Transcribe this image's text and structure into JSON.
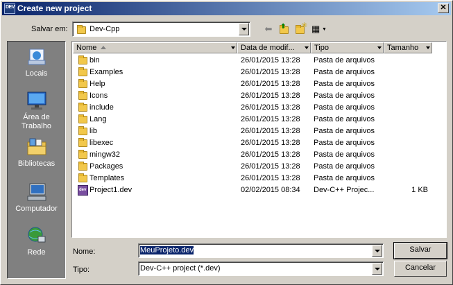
{
  "window": {
    "title": "Create new project",
    "app_icon_text": "DEV"
  },
  "toolbar": {
    "lookin_label": "Salvar em:",
    "lookin_value": "Dev-Cpp",
    "back_icon": "back-arrow-icon",
    "up_icon": "up-folder-icon",
    "new_folder_icon": "new-folder-icon",
    "views_icon": "views-menu-icon"
  },
  "places": [
    {
      "label": "Locais",
      "icon": "recent-places-icon"
    },
    {
      "label": "Área de Trabalho",
      "icon": "desktop-icon"
    },
    {
      "label": "Bibliotecas",
      "icon": "libraries-icon"
    },
    {
      "label": "Computador",
      "icon": "computer-icon"
    },
    {
      "label": "Rede",
      "icon": "network-icon"
    }
  ],
  "columns": {
    "name": "Nome",
    "date": "Data de modif...",
    "type": "Tipo",
    "size": "Tamanho"
  },
  "files": [
    {
      "name": "bin",
      "date": "26/01/2015 13:28",
      "type": "Pasta de arquivos",
      "size": "",
      "kind": "folder"
    },
    {
      "name": "Examples",
      "date": "26/01/2015 13:28",
      "type": "Pasta de arquivos",
      "size": "",
      "kind": "folder"
    },
    {
      "name": "Help",
      "date": "26/01/2015 13:28",
      "type": "Pasta de arquivos",
      "size": "",
      "kind": "folder"
    },
    {
      "name": "Icons",
      "date": "26/01/2015 13:28",
      "type": "Pasta de arquivos",
      "size": "",
      "kind": "folder"
    },
    {
      "name": "include",
      "date": "26/01/2015 13:28",
      "type": "Pasta de arquivos",
      "size": "",
      "kind": "folder"
    },
    {
      "name": "Lang",
      "date": "26/01/2015 13:28",
      "type": "Pasta de arquivos",
      "size": "",
      "kind": "folder"
    },
    {
      "name": "lib",
      "date": "26/01/2015 13:28",
      "type": "Pasta de arquivos",
      "size": "",
      "kind": "folder"
    },
    {
      "name": "libexec",
      "date": "26/01/2015 13:28",
      "type": "Pasta de arquivos",
      "size": "",
      "kind": "folder"
    },
    {
      "name": "mingw32",
      "date": "26/01/2015 13:28",
      "type": "Pasta de arquivos",
      "size": "",
      "kind": "folder"
    },
    {
      "name": "Packages",
      "date": "26/01/2015 13:28",
      "type": "Pasta de arquivos",
      "size": "",
      "kind": "folder"
    },
    {
      "name": "Templates",
      "date": "26/01/2015 13:28",
      "type": "Pasta de arquivos",
      "size": "",
      "kind": "folder"
    },
    {
      "name": "Project1.dev",
      "date": "02/02/2015 08:34",
      "type": "Dev-C++ Projec...",
      "size": "1 KB",
      "kind": "dev-file"
    }
  ],
  "form": {
    "name_label": "Nome:",
    "name_value": "MeuProjeto.dev",
    "type_label": "Tipo:",
    "type_value": "Dev-C++ project (*.dev)"
  },
  "buttons": {
    "save": "Salvar",
    "cancel": "Cancelar"
  },
  "colors": {
    "title_start": "#0a246a",
    "title_end": "#a6caf0",
    "face": "#d4d0c8",
    "places_bg": "#808080",
    "selection": "#0a246a"
  }
}
